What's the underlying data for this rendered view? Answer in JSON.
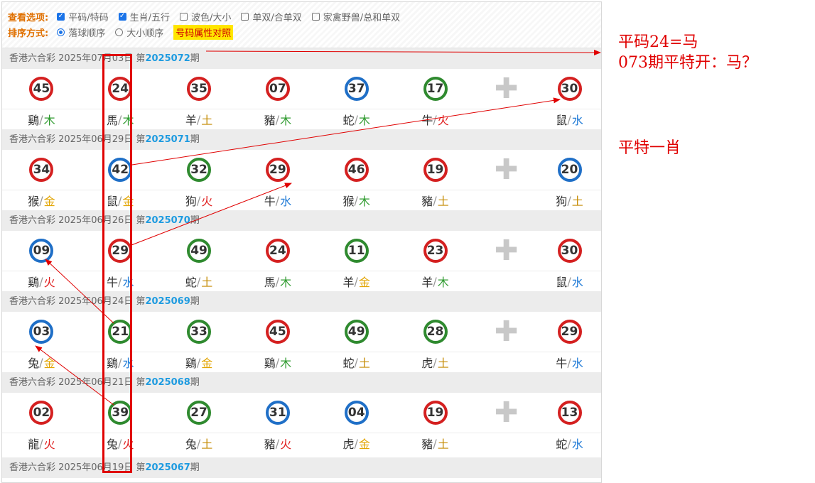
{
  "options": {
    "view_label": "查看选项:",
    "view_items": [
      {
        "label": "平码/特码",
        "checked": true
      },
      {
        "label": "生肖/五行",
        "checked": true
      },
      {
        "label": "波色/大小",
        "checked": false
      },
      {
        "label": "单双/合单双",
        "checked": false
      },
      {
        "label": "家禽野兽/总和单双",
        "checked": false
      }
    ],
    "sort_label": "排序方式:",
    "sort_items": [
      {
        "label": "落球顺序",
        "selected": true
      },
      {
        "label": "大小顺序",
        "selected": false
      }
    ],
    "attr_button": "号码属性对照"
  },
  "draws": [
    {
      "head": "香港六合彩 2025年07月03日 第",
      "issue": "2025072",
      "suffix": "期",
      "balls": [
        {
          "n": "45",
          "c": "red",
          "z": "鷄",
          "e": "木",
          "ek": "wood"
        },
        {
          "n": "24",
          "c": "red",
          "z": "馬",
          "e": "木",
          "ek": "wood"
        },
        {
          "n": "35",
          "c": "red",
          "z": "羊",
          "e": "土",
          "ek": "earth"
        },
        {
          "n": "07",
          "c": "red",
          "z": "豬",
          "e": "木",
          "ek": "wood"
        },
        {
          "n": "37",
          "c": "blue",
          "z": "蛇",
          "e": "木",
          "ek": "wood"
        },
        {
          "n": "17",
          "c": "green",
          "z": "牛",
          "e": "火",
          "ek": "fire"
        }
      ],
      "special": {
        "n": "30",
        "c": "red",
        "z": "鼠",
        "e": "水",
        "ek": "water"
      }
    },
    {
      "head": "香港六合彩 2025年06月29日 第",
      "issue": "2025071",
      "suffix": "期",
      "balls": [
        {
          "n": "34",
          "c": "red",
          "z": "猴",
          "e": "金",
          "ek": "metal"
        },
        {
          "n": "42",
          "c": "blue",
          "z": "鼠",
          "e": "金",
          "ek": "metal"
        },
        {
          "n": "32",
          "c": "green",
          "z": "狗",
          "e": "火",
          "ek": "fire"
        },
        {
          "n": "29",
          "c": "red",
          "z": "牛",
          "e": "水",
          "ek": "water"
        },
        {
          "n": "46",
          "c": "red",
          "z": "猴",
          "e": "木",
          "ek": "wood"
        },
        {
          "n": "19",
          "c": "red",
          "z": "豬",
          "e": "土",
          "ek": "earth"
        }
      ],
      "special": {
        "n": "20",
        "c": "blue",
        "z": "狗",
        "e": "土",
        "ek": "earth"
      }
    },
    {
      "head": "香港六合彩 2025年06月26日 第",
      "issue": "2025070",
      "suffix": "期",
      "balls": [
        {
          "n": "09",
          "c": "blue",
          "z": "鷄",
          "e": "火",
          "ek": "fire"
        },
        {
          "n": "29",
          "c": "red",
          "z": "牛",
          "e": "水",
          "ek": "water"
        },
        {
          "n": "49",
          "c": "green",
          "z": "蛇",
          "e": "土",
          "ek": "earth"
        },
        {
          "n": "24",
          "c": "red",
          "z": "馬",
          "e": "木",
          "ek": "wood"
        },
        {
          "n": "11",
          "c": "green",
          "z": "羊",
          "e": "金",
          "ek": "metal"
        },
        {
          "n": "23",
          "c": "red",
          "z": "羊",
          "e": "木",
          "ek": "wood"
        }
      ],
      "special": {
        "n": "30",
        "c": "red",
        "z": "鼠",
        "e": "水",
        "ek": "water"
      }
    },
    {
      "head": "香港六合彩 2025年06月24日 第",
      "issue": "2025069",
      "suffix": "期",
      "balls": [
        {
          "n": "03",
          "c": "blue",
          "z": "兔",
          "e": "金",
          "ek": "metal"
        },
        {
          "n": "21",
          "c": "green",
          "z": "鷄",
          "e": "水",
          "ek": "water"
        },
        {
          "n": "33",
          "c": "green",
          "z": "鷄",
          "e": "金",
          "ek": "metal"
        },
        {
          "n": "45",
          "c": "red",
          "z": "鷄",
          "e": "木",
          "ek": "wood"
        },
        {
          "n": "49",
          "c": "green",
          "z": "蛇",
          "e": "土",
          "ek": "earth"
        },
        {
          "n": "28",
          "c": "green",
          "z": "虎",
          "e": "土",
          "ek": "earth"
        }
      ],
      "special": {
        "n": "29",
        "c": "red",
        "z": "牛",
        "e": "水",
        "ek": "water"
      }
    },
    {
      "head": "香港六合彩 2025年06月21日 第",
      "issue": "2025068",
      "suffix": "期",
      "balls": [
        {
          "n": "02",
          "c": "red",
          "z": "龍",
          "e": "火",
          "ek": "fire"
        },
        {
          "n": "39",
          "c": "green",
          "z": "兔",
          "e": "火",
          "ek": "fire"
        },
        {
          "n": "27",
          "c": "green",
          "z": "兔",
          "e": "土",
          "ek": "earth"
        },
        {
          "n": "31",
          "c": "blue",
          "z": "豬",
          "e": "火",
          "ek": "fire"
        },
        {
          "n": "04",
          "c": "blue",
          "z": "虎",
          "e": "金",
          "ek": "metal"
        },
        {
          "n": "19",
          "c": "red",
          "z": "豬",
          "e": "土",
          "ek": "earth"
        }
      ],
      "special": {
        "n": "13",
        "c": "red",
        "z": "蛇",
        "e": "水",
        "ek": "water"
      }
    }
  ],
  "last_head": {
    "head": "香港六合彩 2025年06月19日 第",
    "issue": "2025067",
    "suffix": "期"
  },
  "annotations": {
    "note1": "平码24=马",
    "note2": "073期平特开：马？",
    "note3": "平特一肖"
  },
  "colors": {
    "red": "#d42020",
    "blue": "#1f6fc7",
    "green": "#2f8a2f",
    "annotation": "#e00000",
    "issue": "#1e9be0"
  }
}
